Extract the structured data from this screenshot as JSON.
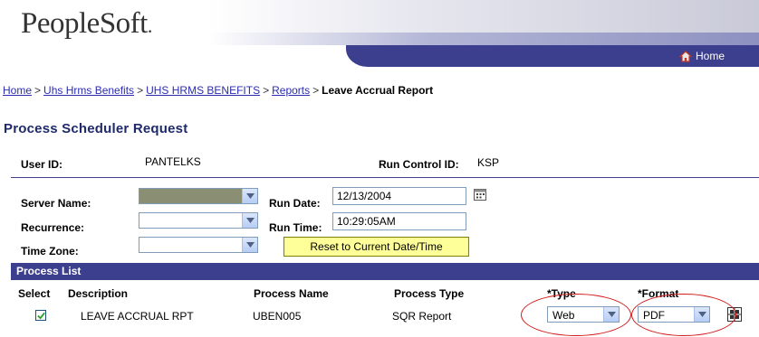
{
  "header": {
    "logo_text": "PeopleSoft",
    "logo_dot": ".",
    "home_label": "Home"
  },
  "breadcrumb": {
    "items": [
      "Home",
      "Uhs Hrms Benefits",
      "UHS HRMS BENEFITS",
      "Reports"
    ],
    "current": "Leave Accrual Report",
    "separator": ">"
  },
  "page": {
    "title": "Process Scheduler Request"
  },
  "info": {
    "user_id_label": "User ID:",
    "user_id_value": "PANTELKS",
    "run_control_label": "Run Control ID:",
    "run_control_value": "KSP"
  },
  "form": {
    "server_name_label": "Server Name:",
    "server_name_value": "",
    "recurrence_label": "Recurrence:",
    "recurrence_value": "",
    "time_zone_label": "Time Zone:",
    "time_zone_value": "",
    "run_date_label": "Run Date:",
    "run_date_value": "12/13/2004",
    "run_time_label": "Run Time:",
    "run_time_value": "10:29:05AM",
    "reset_label": "Reset to Current Date/Time"
  },
  "process_list": {
    "title": "Process List",
    "columns": {
      "select": "Select",
      "description": "Description",
      "process_name": "Process Name",
      "process_type": "Process Type",
      "type": "*Type",
      "format": "*Format"
    },
    "rows": [
      {
        "selected": true,
        "description": "LEAVE ACCRUAL RPT",
        "process_name": "UBEN005",
        "process_type": "SQR Report",
        "type": "Web",
        "format": "PDF"
      }
    ]
  },
  "colors": {
    "brand_bar": "#3c3f8d",
    "title": "#1f2a6b",
    "link": "#2b2bb3",
    "highlight_button": "#ffff99",
    "annotation": "#d21a1a"
  }
}
